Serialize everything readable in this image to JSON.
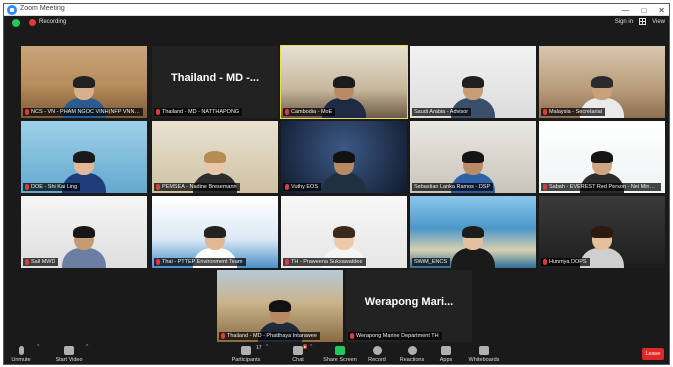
{
  "window": {
    "title": "Zoom Meeting",
    "controls": [
      "—",
      "□",
      "✕"
    ]
  },
  "status": {
    "recording_label": "Recording",
    "signin_label": "Sign in",
    "view_label": "View"
  },
  "tiles": [
    {
      "id": "t1",
      "name": "NCS - VN - PHAM NGOC VINH(NFP VNN-CS)",
      "style": "conference",
      "muted": true
    },
    {
      "id": "t2",
      "name": "Thailand - MD - NATTHAPONG",
      "big_name": "Thailand - MD -...",
      "style": "nameonly",
      "muted": true
    },
    {
      "id": "t3",
      "name": "Cambodia - MoE",
      "style": "office-flag",
      "muted": true,
      "active": true
    },
    {
      "id": "t4",
      "name": "Saudi Arabia - Advisor",
      "style": "mask",
      "muted": false
    },
    {
      "id": "t5",
      "name": "Malaysia - Secretariat",
      "style": "deskroom",
      "muted": true
    },
    {
      "id": "t6",
      "name": "DOE - Shi Kai Ling",
      "style": "woman-blue",
      "muted": true
    },
    {
      "id": "t7",
      "name": "PEMSEA - Nadine Bresemann",
      "style": "woman-beige",
      "muted": true
    },
    {
      "id": "t8",
      "name": "Vuthy EOS",
      "style": "man-dark",
      "muted": true
    },
    {
      "id": "t9",
      "name": "Sebastian Lanka Ramos - DSP",
      "style": "man-blue",
      "muted": false
    },
    {
      "id": "t10",
      "name": "Sabah - EVEREST Red Person - Nei Ming Lee",
      "style": "man-slide",
      "muted": true
    },
    {
      "id": "t11",
      "name": "Sail MWD",
      "style": "man-white",
      "muted": true
    },
    {
      "id": "t12",
      "name": "Thai - PTTEP Environment Team",
      "style": "woman-slide",
      "muted": true
    },
    {
      "id": "t13",
      "name": "TH - Praweena Suksawatdee",
      "style": "woman-white",
      "muted": true
    },
    {
      "id": "t14",
      "name": "SWiM_ENCS",
      "style": "woman-beach",
      "muted": false
    },
    {
      "id": "t15",
      "name": "Hunmya DOPS",
      "style": "woman-dark",
      "muted": true
    },
    {
      "id": "t16",
      "name": "Thailand - MD - Phatthaya Intarawee",
      "style": "man-building",
      "muted": true
    },
    {
      "id": "t17",
      "name": "Werapong Marine Department TH",
      "big_name": "Werapong Mari...",
      "style": "nameonly",
      "muted": true
    }
  ],
  "toolbar": {
    "unmute": "Unmute",
    "start_video": "Start Video",
    "participants": "Participants",
    "participants_count": "17",
    "chat": "Chat",
    "share_screen": "Share Screen",
    "record": "Record",
    "reactions": "Reactions",
    "apps": "Apps",
    "whiteboards": "Whiteboards",
    "leave": "Leave"
  },
  "colors": {
    "bg": "#1a1a1a",
    "accent": "#2d8cff",
    "share": "#23c85a",
    "leave": "#e02828",
    "active_border": "#e9e04a"
  }
}
